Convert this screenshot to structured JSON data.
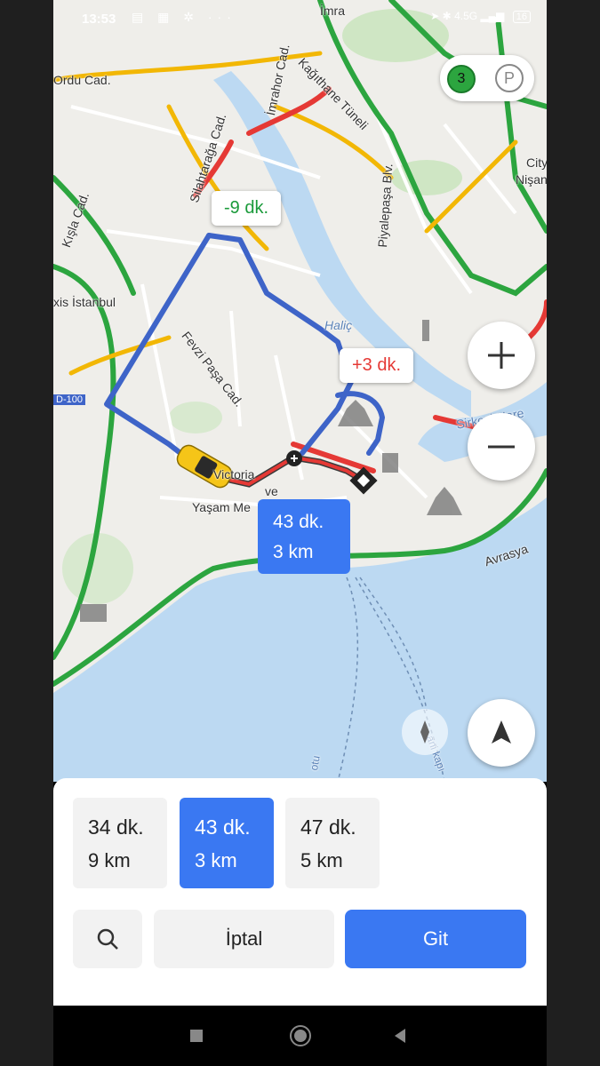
{
  "status_bar": {
    "time": "13:53",
    "left_icons": [
      "calendar-icon",
      "grid-icon",
      "pinwheel-icon",
      "more-icon"
    ],
    "more": "···",
    "network": "4.5G",
    "battery": "16"
  },
  "map": {
    "labels": {
      "ordu": "Ordu Cad.",
      "silahtaraga": "Silahtarağa Cad.",
      "imrahor": "İmrahor Cad.",
      "kagithane": "Kağıthane Tüneli",
      "piyalepasa": "Piyalepaşa Blv.",
      "kisla": "Kışla Cad.",
      "axis": "xis İstanbul",
      "fevzi": "Fevzi Paşa Cad.",
      "halic": "Haliç",
      "sirkeci": "Sirkeci-Hare",
      "avrasya": "Avrasya",
      "city": "City",
      "nisan": "Nişan",
      "victoria1": "Victoria",
      "victoria2": "Yaşam Me",
      "ve": "ve",
      "road100": "D-100",
      "imra_top": "İmra",
      "ferry1": "otu",
      "ferry2": "ani kapı"
    },
    "traffic_level": "3",
    "parking": "P",
    "bubble_fast": "-9 dk.",
    "bubble_slow": "+3 dk.",
    "bubble_main_time": "43 dk.",
    "bubble_main_dist": "3 km"
  },
  "routes": [
    {
      "time": "34 dk.",
      "distance": "9 km",
      "active": false
    },
    {
      "time": "43 dk.",
      "distance": "3 km",
      "active": true
    },
    {
      "time": "47 dk.",
      "distance": "5 km",
      "active": false
    }
  ],
  "actions": {
    "cancel_label": "İptal",
    "go_label": "Git"
  },
  "colors": {
    "accent": "#3a78f2",
    "route_blue": "#3e64c8",
    "traffic_green": "#2ca53f",
    "traffic_red": "#e53935",
    "water": "#bcd9f2"
  }
}
